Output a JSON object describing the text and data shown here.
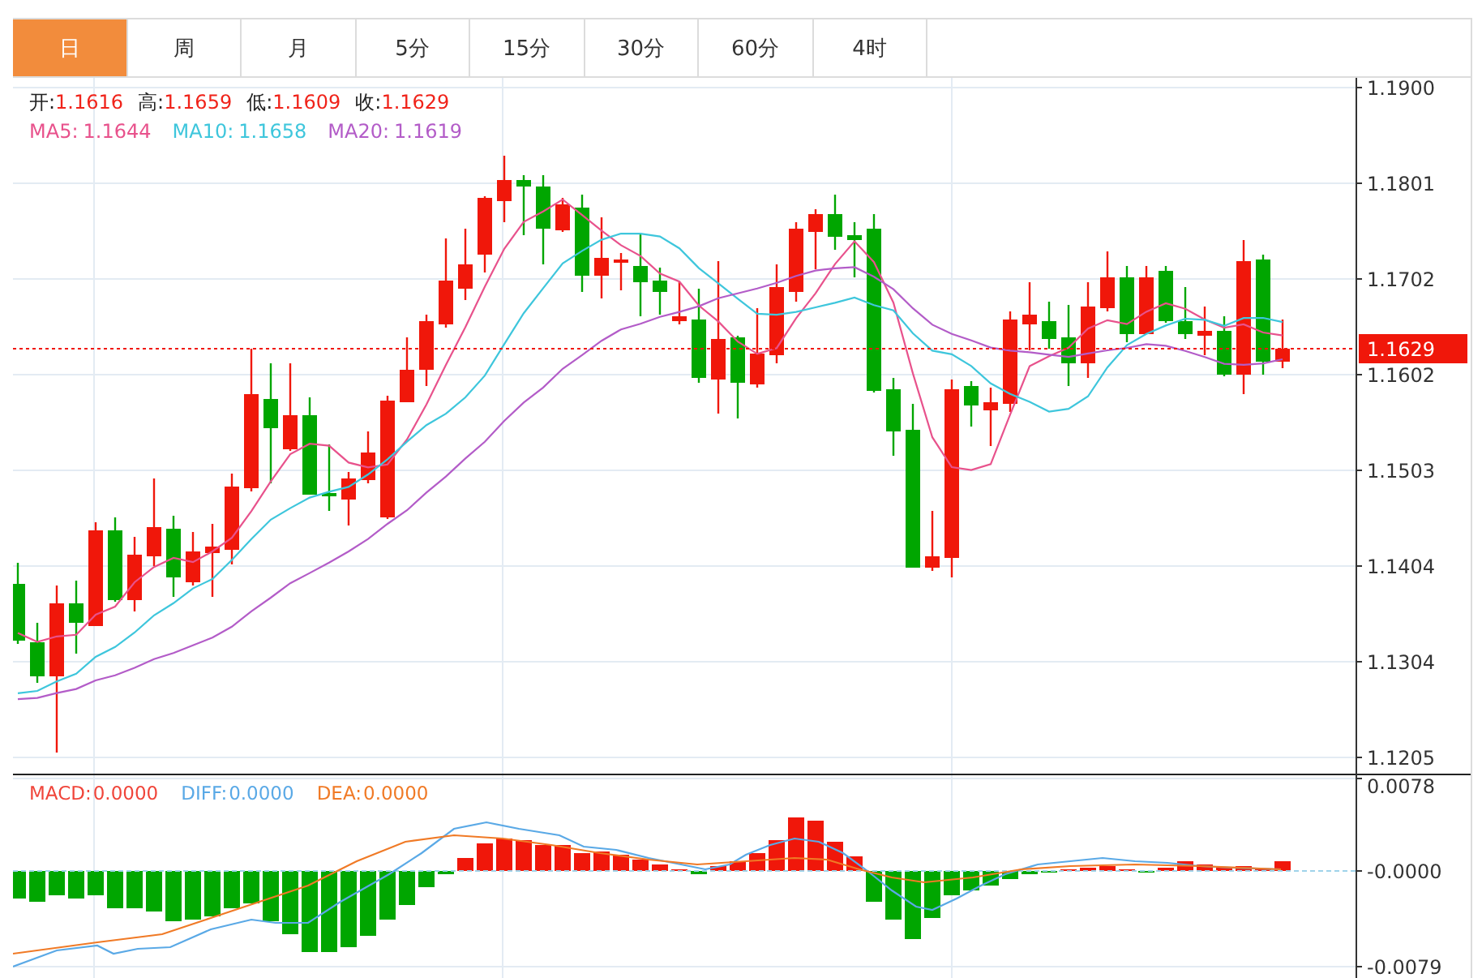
{
  "tabs": [
    {
      "label": "日",
      "selected": true
    },
    {
      "label": "周",
      "selected": false
    },
    {
      "label": "月",
      "selected": false
    },
    {
      "label": "5分",
      "selected": false
    },
    {
      "label": "15分",
      "selected": false
    },
    {
      "label": "30分",
      "selected": false
    },
    {
      "label": "60分",
      "selected": false
    },
    {
      "label": "4时",
      "selected": false
    }
  ],
  "price_legend": [
    {
      "label": "开:",
      "value": "1.1616"
    },
    {
      "label": "高:",
      "value": "1.1659"
    },
    {
      "label": "低:",
      "value": "1.1609"
    },
    {
      "label": "收:",
      "value": "1.1629"
    }
  ],
  "ma_legend": [
    {
      "label": "MA5:",
      "value": "1.1644",
      "color": "#e8528c"
    },
    {
      "label": "MA10:",
      "value": "1.1658",
      "color": "#3ec6dc"
    },
    {
      "label": "MA20:",
      "value": "1.1619",
      "color": "#b35cc8"
    }
  ],
  "price_axis": {
    "ticks": [
      "1.1900",
      "1.1801",
      "1.1702",
      "1.1602",
      "1.1503",
      "1.1404",
      "1.1304",
      "1.1205"
    ],
    "current_price": "1.1629"
  },
  "macd_legend": [
    {
      "label": "MACD:",
      "value": "0.0000",
      "color": "#f0453a"
    },
    {
      "label": "DIFF:",
      "value": "0.0000",
      "color": "#5aa9e6"
    },
    {
      "label": "DEA:",
      "value": "0.0000",
      "color": "#f07a26"
    }
  ],
  "macd_axis": {
    "ticks": [
      "0.0078",
      "-0.0000",
      "-0.0079"
    ]
  }
}
